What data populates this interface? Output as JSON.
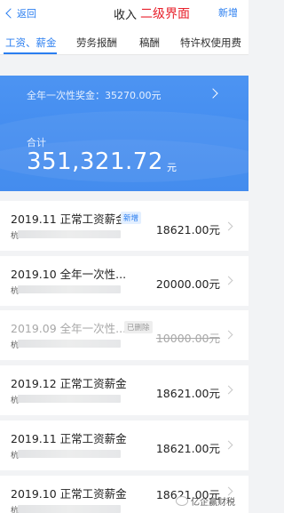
{
  "navbar": {
    "back_label": "返回",
    "title": "收入",
    "annotation": "二级界面",
    "add_label": "新增"
  },
  "tabs": [
    {
      "label": "工资、薪金",
      "active": true
    },
    {
      "label": "劳务报酬",
      "active": false
    },
    {
      "label": "稿酬",
      "active": false
    },
    {
      "label": "特许权使用费",
      "active": false
    }
  ],
  "summary": {
    "bonus_text": "全年一次性奖金：35270.00元",
    "total_label": "合计",
    "total_value": "351,321.72",
    "total_unit": "元"
  },
  "records": [
    {
      "title": "2019.11 正常工资薪金",
      "badge": "新增",
      "company_prefix": "杭",
      "amount": "18621.00元",
      "status": "new"
    },
    {
      "title": "2019.10 全年一次性...",
      "badge": "",
      "company_prefix": "杭",
      "amount": "20000.00元",
      "status": "normal"
    },
    {
      "title": "2019.09 全年一次性...",
      "badge": "已删除",
      "company_prefix": "杭",
      "amount": "10000.00元",
      "status": "deleted"
    },
    {
      "title": "2019.12 正常工资薪金",
      "badge": "",
      "company_prefix": "杭",
      "amount": "18621.00元",
      "status": "normal"
    },
    {
      "title": "2019.11 正常工资薪金",
      "badge": "",
      "company_prefix": "杭",
      "amount": "18621.00元",
      "status": "normal"
    },
    {
      "title": "2019.10 正常工资薪金",
      "badge": "",
      "company_prefix": "杭",
      "amount": "18621.00元",
      "status": "normal"
    }
  ],
  "watermark": "亿企赢财税",
  "colors": {
    "accent": "#2a7ef0",
    "banner": "#3a86ee",
    "annotation": "#e8212c"
  }
}
